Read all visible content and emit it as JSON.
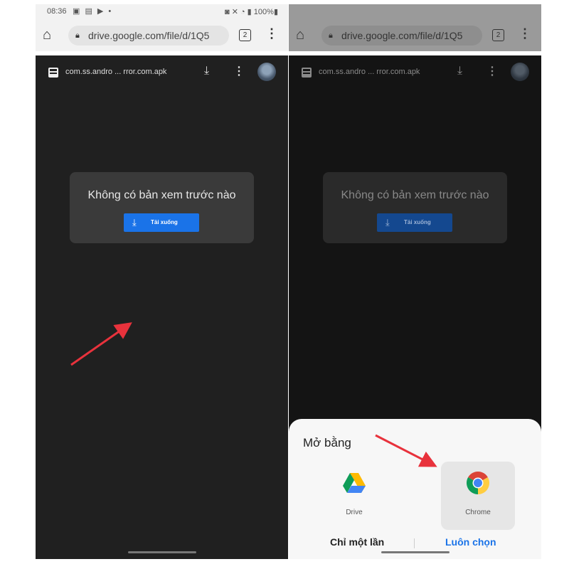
{
  "status": {
    "time": "08:36",
    "battery": "100%"
  },
  "browser": {
    "url": "drive.google.com/file/d/1Q5",
    "tab_count": "2"
  },
  "drive": {
    "filename": "com.ss.andro ... rror.com.apk"
  },
  "preview": {
    "message": "Không có bản xem trước nào",
    "download_label": "Tải xuống"
  },
  "open_with": {
    "title": "Mở bằng",
    "apps": [
      {
        "name": "Drive"
      },
      {
        "name": "Chrome"
      }
    ],
    "just_once": "Chỉ một lần",
    "always": "Luôn chọn"
  },
  "colors": {
    "accent": "#1a73e8",
    "arrow": "#e8323c",
    "viewer_bg": "#202020"
  }
}
